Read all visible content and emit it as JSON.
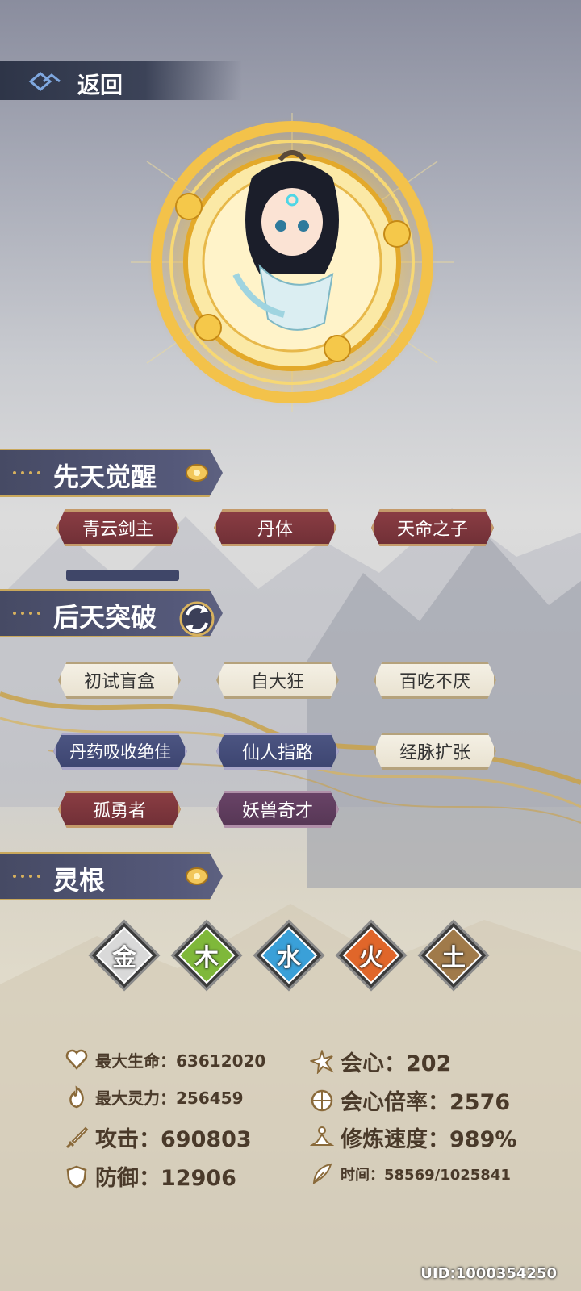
{
  "header": {
    "back_label": "返回"
  },
  "innate": {
    "title": "先天觉醒",
    "tags": [
      {
        "label": "青云剑主",
        "style": "red"
      },
      {
        "label": "丹体",
        "style": "red"
      },
      {
        "label": "天命之子",
        "style": "red"
      }
    ]
  },
  "acquired": {
    "title": "后天突破",
    "tags": [
      {
        "label": "初试盲盒",
        "style": "white"
      },
      {
        "label": "自大狂",
        "style": "white"
      },
      {
        "label": "百吃不厌",
        "style": "white"
      },
      {
        "label": "丹药吸收绝佳",
        "style": "blue"
      },
      {
        "label": "仙人指路",
        "style": "blue"
      },
      {
        "label": "经脉扩张",
        "style": "white"
      },
      {
        "label": "孤勇者",
        "style": "red"
      },
      {
        "label": "妖兽奇才",
        "style": "purple"
      }
    ]
  },
  "spirit_root": {
    "title": "灵根",
    "elements": [
      {
        "char": "金",
        "color": "#d9d9d9",
        "icon": "metal-element-icon"
      },
      {
        "char": "木",
        "color": "#7fb83a",
        "icon": "wood-element-icon"
      },
      {
        "char": "水",
        "color": "#3aa0d8",
        "icon": "water-element-icon"
      },
      {
        "char": "火",
        "color": "#e0662a",
        "icon": "fire-element-icon"
      },
      {
        "char": "土",
        "color": "#a07a4a",
        "icon": "earth-element-icon"
      }
    ]
  },
  "stats": {
    "max_hp": "最大生命：63612020",
    "max_spirit": "最大灵力：256459",
    "attack": "攻击：690803",
    "defense": "防御：12906",
    "crit": "会心：202",
    "crit_rate": "会心倍率：2576",
    "cultivation_speed": "修炼速度：989%",
    "time": "时间：58569/1025841"
  },
  "uid": "UID:1000354250"
}
